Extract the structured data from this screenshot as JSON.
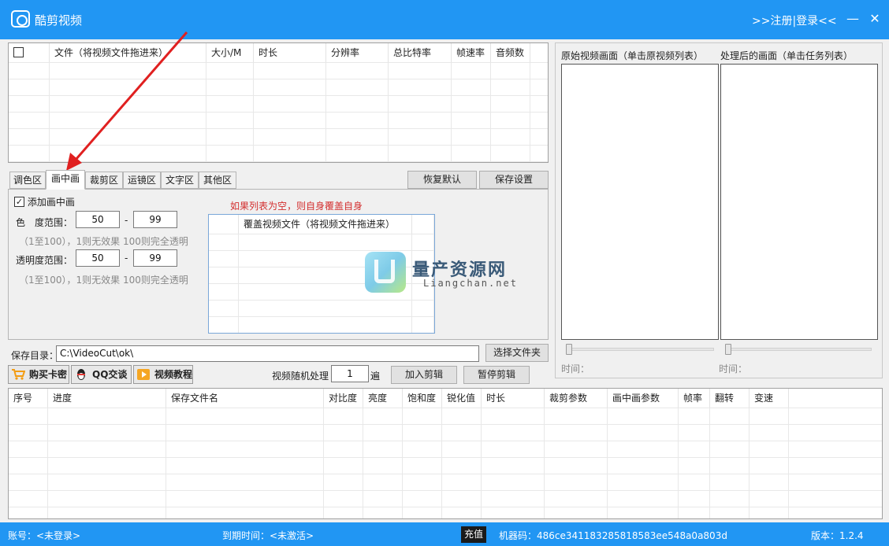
{
  "titlebar": {
    "title": "酷剪视频",
    "login": ">>注册|登录<<",
    "minimize": "—",
    "close": "✕"
  },
  "file_grid": {
    "columns": [
      "文件（将视频文件拖进来）",
      "大小/M",
      "时长",
      "分辨率",
      "总比特率",
      "帧速率",
      "音频数"
    ]
  },
  "tabs": [
    "调色区",
    "画中画",
    "裁剪区",
    "运镜区",
    "文字区",
    "其他区"
  ],
  "active_tab": "画中画",
  "buttons": {
    "restore_default": "恢复默认",
    "save_settings": "保存设置",
    "choose_folder": "选择文件夹",
    "add_edit": "加入剪辑",
    "pause_edit": "暂停剪辑"
  },
  "pip": {
    "add_pip_label": "添加画中画",
    "color_range_label": "色　度范围：",
    "color_min": "50",
    "color_max": "99",
    "dash": "-",
    "color_hint": "（1至100），1则无效果 100则完全透明",
    "alpha_range_label": "透明度范围：",
    "alpha_min": "50",
    "alpha_max": "99",
    "alpha_hint": "（1至100），1则无效果 100则完全透明",
    "warning": "如果列表为空，则自身覆盖自身",
    "overlay_column": "覆盖视频文件（将视频文件拖进来）"
  },
  "preview": {
    "original_label": "原始视频画面（单击原视频列表）",
    "processed_label": "处理后的画面（单击任务列表）",
    "time_label_1": "时间：",
    "time_label_2": "时间："
  },
  "save": {
    "label": "保存目录：",
    "path": "C:\\VideoCut\\ok\\"
  },
  "links": {
    "buy": "购买卡密",
    "qq": "QQ交谈",
    "tutorial": "视频教程"
  },
  "random": {
    "label": "视频随机处理",
    "value": "1",
    "unit": "遍"
  },
  "task_grid": {
    "columns": [
      "序号",
      "进度",
      "保存文件名",
      "对比度",
      "亮度",
      "饱和度",
      "锐化值",
      "时长",
      "裁剪参数",
      "画中画参数",
      "帧率",
      "翻转",
      "变速"
    ]
  },
  "watermark": {
    "title": "量产资源网",
    "subtitle": "Liangchan.net"
  },
  "status": {
    "account": "账号：<未登录>",
    "expire": "到期时间：<未激活>",
    "recharge": "充值",
    "machine": "机器码：486ce341183285818583ee548a0a803d",
    "version": "版本：1.2.4"
  },
  "colors": {
    "accent": "#2196f3",
    "warning": "#d32f2f",
    "arrow": "#e02020"
  }
}
